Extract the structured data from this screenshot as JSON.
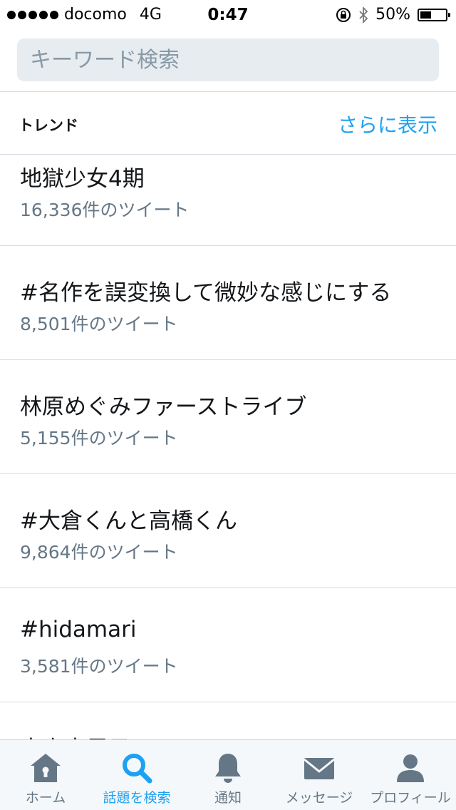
{
  "status_bar": {
    "carrier": "docomo",
    "network": "4G",
    "time": "0:47",
    "battery_percent_label": "50%",
    "battery_level": 0.5
  },
  "search": {
    "placeholder": "キーワード検索"
  },
  "trends": {
    "title": "トレンド",
    "show_more": "さらに表示",
    "items": [
      {
        "name": "地獄少女4期",
        "count": "16,336件のツイート"
      },
      {
        "name": "#名作を誤変換して微妙な感じにする",
        "count": "8,501件のツイート"
      },
      {
        "name": "林原めぐみファーストライブ",
        "count": "5,155件のツイート"
      },
      {
        "name": "#大倉くんと高橋くん",
        "count": "9,864件のツイート"
      },
      {
        "name": "#hidamari",
        "count": "3,581件のツイート"
      },
      {
        "name": "吉高由里子",
        "count": ""
      }
    ]
  },
  "tab_bar": {
    "active_color": "#1da1f2",
    "inactive_color": "#657786",
    "tabs": [
      {
        "label": "ホーム",
        "icon": "home-icon"
      },
      {
        "label": "話題を検索",
        "icon": "search-icon"
      },
      {
        "label": "通知",
        "icon": "bell-icon"
      },
      {
        "label": "メッセージ",
        "icon": "envelope-icon"
      },
      {
        "label": "プロフィール",
        "icon": "person-icon"
      }
    ]
  }
}
